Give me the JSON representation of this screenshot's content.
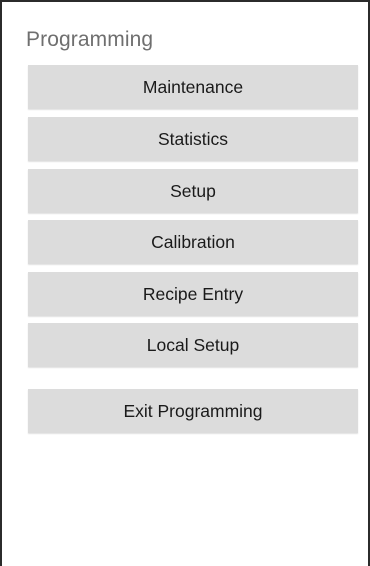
{
  "header": {
    "title": "Programming"
  },
  "menu": {
    "maintenance": "Maintenance",
    "statistics": "Statistics",
    "setup": "Setup",
    "calibration": "Calibration",
    "recipe_entry": "Recipe Entry",
    "local_setup": "Local Setup",
    "exit_programming": "Exit Programming"
  }
}
